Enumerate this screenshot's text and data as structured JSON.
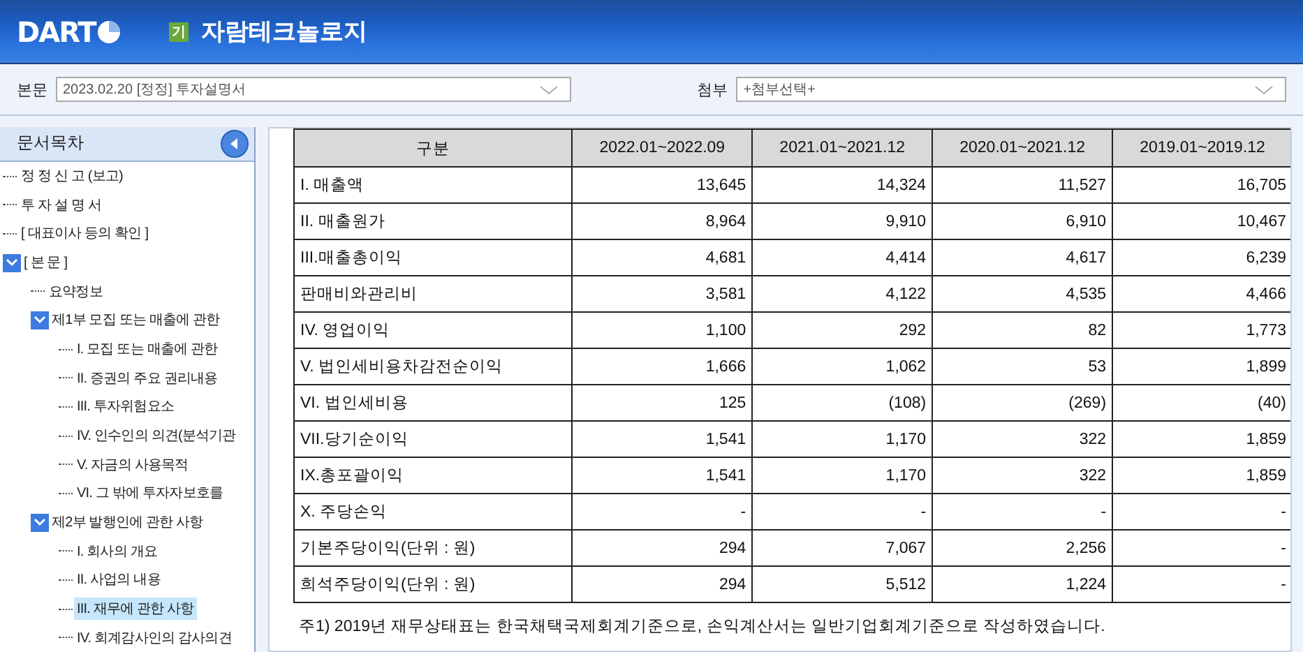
{
  "header": {
    "logo": "DART",
    "badge": "기",
    "company": "자람테크놀로지"
  },
  "selectors": [
    {
      "label": "본문",
      "value": "2023.02.20 [정정] 투자설명서"
    },
    {
      "label": "첨부",
      "value": "+첨부선택+"
    }
  ],
  "sidebar": {
    "title": "문서목차",
    "items": [
      {
        "label": "정 정 신 고 (보고)",
        "selected": false
      },
      {
        "label": "투 자 설 명 서",
        "selected": false
      },
      {
        "label": "[ 대표이사 등의 확인 ]",
        "selected": false
      },
      {
        "label": "[ 본 문 ]",
        "selected": false,
        "expanded": true,
        "children": [
          {
            "label": "요약정보",
            "selected": false
          },
          {
            "label": "제1부 모집 또는 매출에 관한",
            "selected": false,
            "expanded": true,
            "children": [
              {
                "label": "I. 모집 또는 매출에 관한",
                "selected": false
              },
              {
                "label": "II. 증권의 주요 권리내용",
                "selected": false
              },
              {
                "label": "III. 투자위험요소",
                "selected": false
              },
              {
                "label": "IV. 인수인의 의견(분석기관",
                "selected": false
              },
              {
                "label": "V. 자금의 사용목적",
                "selected": false
              },
              {
                "label": "VI. 그 밖에 투자자보호를",
                "selected": false
              }
            ]
          },
          {
            "label": "제2부 발행인에 관한 사항",
            "selected": false,
            "expanded": true,
            "children": [
              {
                "label": "I. 회사의 개요",
                "selected": false
              },
              {
                "label": "II. 사업의 내용",
                "selected": false
              },
              {
                "label": "III. 재무에 관한 사항",
                "selected": true
              },
              {
                "label": "IV. 회계감사인의 감사의견",
                "selected": false
              }
            ]
          }
        ]
      }
    ]
  },
  "table": {
    "columns": [
      "구분",
      "2022.01~2022.09",
      "2021.01~2021.12",
      "2020.01~2021.12",
      "2019.01~2019.12"
    ],
    "rows": [
      [
        "I. 매출액",
        "13,645",
        "14,324",
        "11,527",
        "16,705"
      ],
      [
        "II. 매출원가",
        "8,964",
        "9,910",
        "6,910",
        "10,467"
      ],
      [
        "III.매출총이익",
        "4,681",
        "4,414",
        "4,617",
        "6,239"
      ],
      [
        "판매비와관리비",
        "3,581",
        "4,122",
        "4,535",
        "4,466"
      ],
      [
        "IV. 영업이익",
        "1,100",
        "292",
        "82",
        "1,773"
      ],
      [
        "V. 법인세비용차감전순이익",
        "1,666",
        "1,062",
        "53",
        "1,899"
      ],
      [
        "VI. 법인세비용",
        "125",
        "(108)",
        "(269)",
        "(40)"
      ],
      [
        "VII.당기순이익",
        "1,541",
        "1,170",
        "322",
        "1,859"
      ],
      [
        "IX.총포괄이익",
        "1,541",
        "1,170",
        "322",
        "1,859"
      ],
      [
        "X. 주당손익",
        "-",
        "-",
        "-",
        "-"
      ],
      [
        "기본주당이익(단위 : 원)",
        "294",
        "7,067",
        "2,256",
        "-"
      ],
      [
        "희석주당이익(단위 : 원)",
        "294",
        "5,512",
        "1,224",
        "-"
      ]
    ]
  },
  "note": "주1) 2019년 재무상태표는 한국채택국제회계기준으로, 손익계산서는 일반기업회계기준으로 작성하였습니다."
}
